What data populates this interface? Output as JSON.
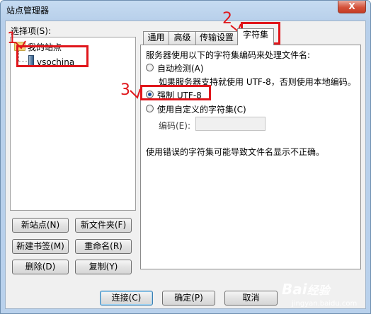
{
  "window": {
    "title": "站点管理器",
    "close_glyph": "X"
  },
  "tree": {
    "label": "选择项(S):",
    "root": "我的站点",
    "child": "vsochina"
  },
  "left_buttons": {
    "new_site": "新站点(N)",
    "new_folder": "新文件夹(F)",
    "new_bookmark": "新建书签(M)",
    "rename": "重命名(R)",
    "delete": "删除(D)",
    "copy": "复制(Y)"
  },
  "tabs": [
    {
      "label": "通用"
    },
    {
      "label": "高级"
    },
    {
      "label": "传输设置"
    },
    {
      "label": "字符集"
    }
  ],
  "charset_panel": {
    "intro": "服务器使用以下的字符集编码来处理文件名:",
    "auto_detect": "自动检测(A)",
    "auto_detect_hint": "如果服务器支持就使用 UTF-8，否则使用本地编码。",
    "force_utf8": "强制 UTF-8",
    "custom": "使用自定义的字符集(C)",
    "encoding_label": "编码(E):",
    "encoding_value": "",
    "warning": "使用错误的字符集可能导致文件名显示不正确。",
    "selected": "force_utf8"
  },
  "dialog_buttons": {
    "connect": "连接(C)",
    "ok": "确定(P)",
    "cancel": "取消"
  },
  "annotations": {
    "step1": "1",
    "step2": "2",
    "step3": "3",
    "color": "#e0161b"
  },
  "watermark": {
    "brand": "Bai",
    "brand2": "经验",
    "url": "jingyan.baidu.com"
  }
}
